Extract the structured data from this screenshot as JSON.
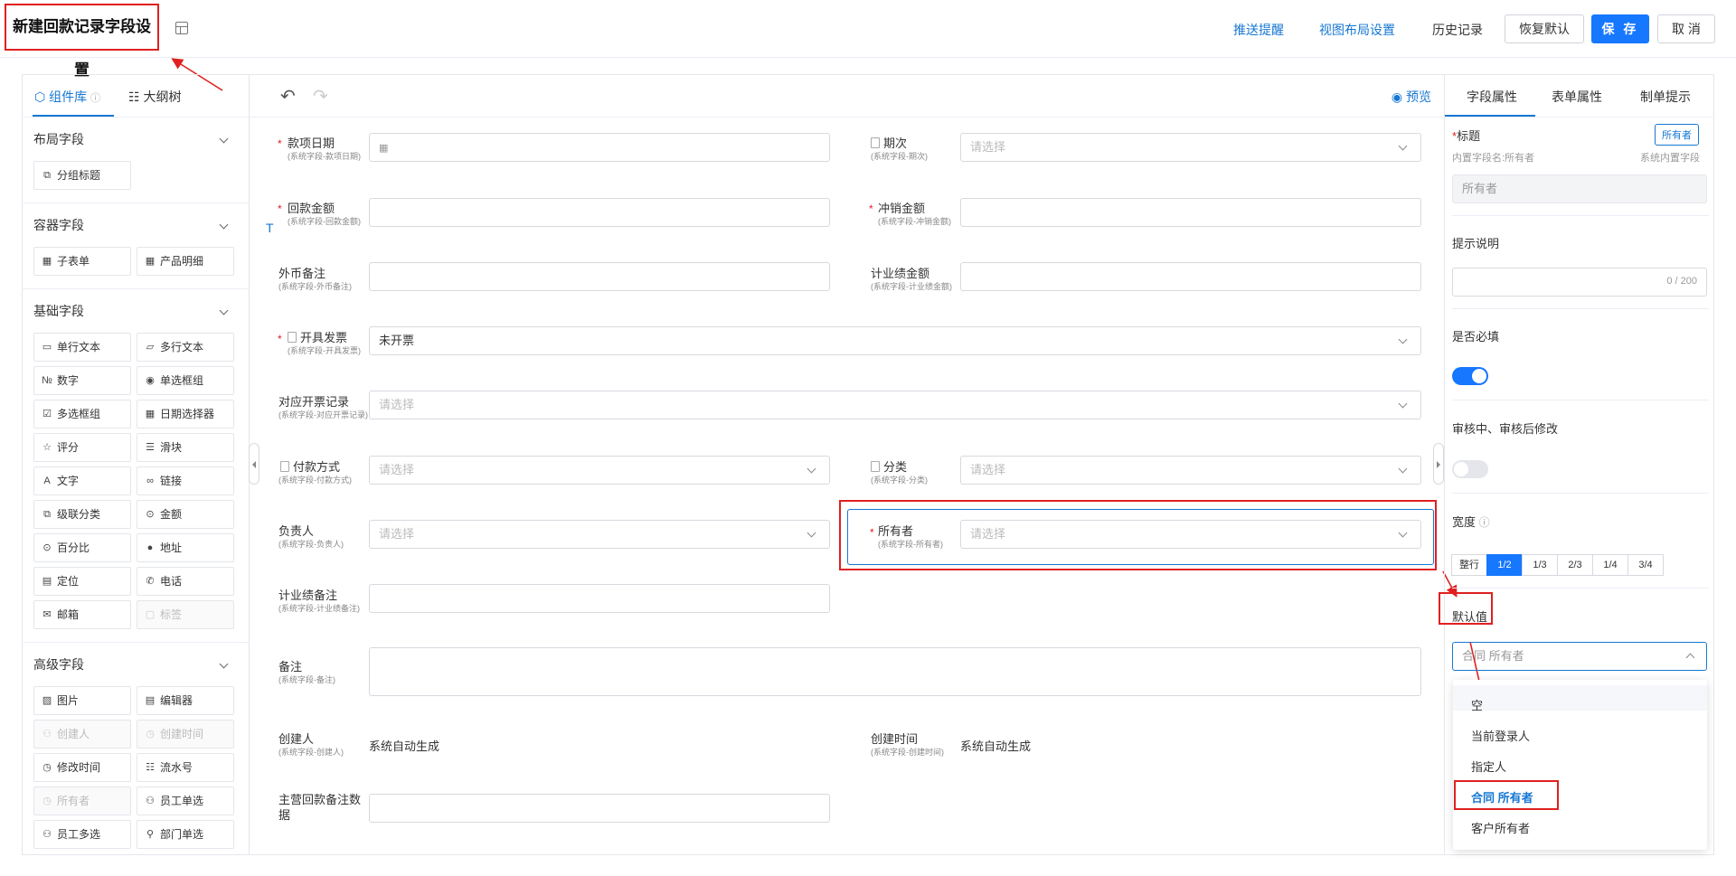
{
  "header": {
    "title": "新建回款记录字段设置",
    "links": [
      "推送提醒",
      "视图布局设置",
      "历史记录"
    ],
    "buttons": {
      "restore": "恢复默认",
      "save": "保 存",
      "cancel": "取 消"
    }
  },
  "left_panel": {
    "tabs": [
      "组件库",
      "大纲树"
    ],
    "sections": [
      {
        "title": "布局字段",
        "items": [
          {
            "label": "分组标题",
            "icon": "group-title-icon",
            "disabled": false
          }
        ]
      },
      {
        "title": "容器字段",
        "items": [
          {
            "label": "子表单",
            "icon": "table-icon",
            "disabled": false
          },
          {
            "label": "产品明细",
            "icon": "table-icon",
            "disabled": false
          }
        ]
      },
      {
        "title": "基础字段",
        "items": [
          {
            "label": "单行文本",
            "icon": "single-line-icon",
            "disabled": false
          },
          {
            "label": "多行文本",
            "icon": "multi-line-icon",
            "disabled": false
          },
          {
            "label": "数字",
            "icon": "number-icon",
            "disabled": false
          },
          {
            "label": "单选框组",
            "icon": "radio-icon",
            "disabled": false
          },
          {
            "label": "多选框组",
            "icon": "checkbox-icon",
            "disabled": false
          },
          {
            "label": "日期选择器",
            "icon": "calendar-icon",
            "disabled": false
          },
          {
            "label": "评分",
            "icon": "star-icon",
            "disabled": false
          },
          {
            "label": "滑块",
            "icon": "slider-icon",
            "disabled": false
          },
          {
            "label": "文字",
            "icon": "text-icon",
            "disabled": false
          },
          {
            "label": "链接",
            "icon": "link-icon",
            "disabled": false
          },
          {
            "label": "级联分类",
            "icon": "cascade-icon",
            "disabled": false
          },
          {
            "label": "金额",
            "icon": "money-icon",
            "disabled": false
          },
          {
            "label": "百分比",
            "icon": "percent-icon",
            "disabled": false
          },
          {
            "label": "地址",
            "icon": "location-pin-icon",
            "disabled": false
          },
          {
            "label": "定位",
            "icon": "locate-doc-icon",
            "disabled": false
          },
          {
            "label": "电话",
            "icon": "phone-icon",
            "disabled": false
          },
          {
            "label": "邮箱",
            "icon": "mail-icon",
            "disabled": false
          },
          {
            "label": "标签",
            "icon": "tag-icon",
            "disabled": true
          }
        ]
      },
      {
        "title": "高级字段",
        "items": [
          {
            "label": "图片",
            "icon": "image-icon",
            "disabled": false
          },
          {
            "label": "编辑器",
            "icon": "editor-icon",
            "disabled": false
          },
          {
            "label": "创建人",
            "icon": "user-icon",
            "disabled": true
          },
          {
            "label": "创建时间",
            "icon": "clock-icon",
            "disabled": true
          },
          {
            "label": "修改时间",
            "icon": "clock-icon",
            "disabled": false
          },
          {
            "label": "流水号",
            "icon": "list-number-icon",
            "disabled": false
          },
          {
            "label": "所有者",
            "icon": "clock-icon",
            "disabled": true
          },
          {
            "label": "员工单选",
            "icon": "user-icon",
            "disabled": false
          },
          {
            "label": "员工多选",
            "icon": "users-icon",
            "disabled": false
          },
          {
            "label": "部门单选",
            "icon": "org-icon",
            "disabled": false
          }
        ]
      }
    ]
  },
  "canvas": {
    "preview": "预览",
    "auto_generated": "系统自动生成",
    "fields": {
      "payment_date": {
        "label": "款项日期",
        "sub": "(系统字段-款项日期)"
      },
      "period": {
        "label": "期次",
        "sub": "(系统字段-期次)",
        "placeholder": "请选择"
      },
      "amount": {
        "label": "回款金额",
        "sub": "(系统字段-回款金额)"
      },
      "writeoff": {
        "label": "冲销金额",
        "sub": "(系统字段-冲销金额)"
      },
      "fx_note": {
        "label": "外币备注",
        "sub": "(系统字段-外币备注)"
      },
      "perf_amount": {
        "label": "计业绩金额",
        "sub": "(系统字段-计业绩金额)"
      },
      "invoice": {
        "label": "开具发票",
        "sub": "(系统字段-开具发票)",
        "value": "未开票"
      },
      "invoice_record": {
        "label": "对应开票记录",
        "sub": "(系统字段-对应开票记录)",
        "placeholder": "请选择"
      },
      "pay_method": {
        "label": "付款方式",
        "sub": "(系统字段-付款方式)",
        "placeholder": "请选择"
      },
      "category": {
        "label": "分类",
        "sub": "(系统字段-分类)",
        "placeholder": "请选择"
      },
      "owner_lead": {
        "label": "负责人",
        "sub": "(系统字段-负责人)",
        "placeholder": "请选择"
      },
      "owner": {
        "label": "所有者",
        "sub": "(系统字段-所有者)",
        "placeholder": "请选择"
      },
      "perf_note": {
        "label": "计业绩备注",
        "sub": "(系统字段-计业绩备注)"
      },
      "remark": {
        "label": "备注",
        "sub": "(系统字段-备注)"
      },
      "creator": {
        "label": "创建人",
        "sub": "(系统字段-创建人)"
      },
      "create_time": {
        "label": "创建时间",
        "sub": "(系统字段-创建时间)"
      },
      "main_note": {
        "label": "主营回款备注数据"
      }
    }
  },
  "right_panel": {
    "tabs": [
      "字段属性",
      "表单属性",
      "制单提示"
    ],
    "title_label": "标题",
    "title_badge": "所有者",
    "builtin_name": "内置字段名:所有者",
    "builtin_tag": "系统内置字段",
    "title_value": "所有者",
    "hint_label": "提示说明",
    "hint_counter": "0 / 200",
    "required_label": "是否必填",
    "required_on": true,
    "edit_label": "审核中、审核后修改",
    "edit_on": false,
    "width_label": "宽度",
    "width_options": [
      "整行",
      "1/2",
      "1/3",
      "2/3",
      "1/4",
      "3/4"
    ],
    "width_selected": "1/2",
    "default_label": "默认值",
    "default_selected": "合同 所有者",
    "default_options": [
      "空",
      "当前登录人",
      "指定人",
      "合同 所有者",
      "客户所有者"
    ]
  },
  "colors": {
    "primary": "#1677ff",
    "link": "#1677d2",
    "annotation": "#e02020"
  }
}
